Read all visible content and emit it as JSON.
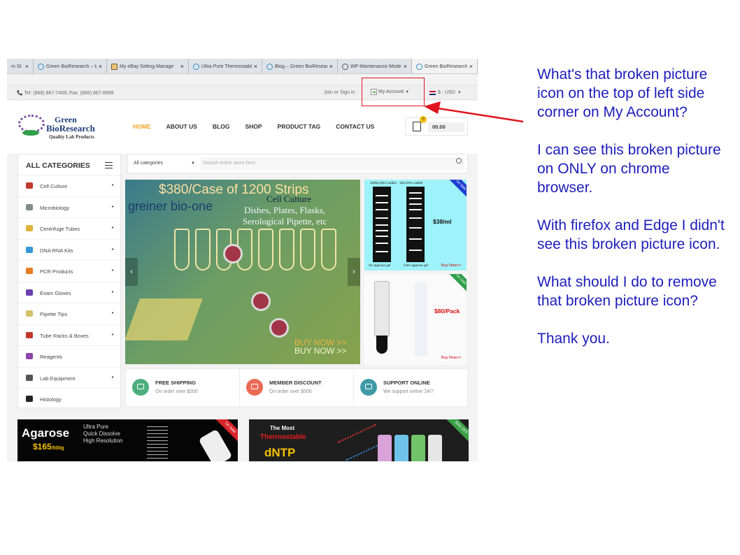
{
  "browser": {
    "tabs": [
      {
        "title": "m St",
        "icon": "page-icon",
        "active": false
      },
      {
        "title": "Green BioResearch – We",
        "icon": "leaf-icon",
        "active": false
      },
      {
        "title": "My eBay Selling Manage",
        "icon": "ebay-icon",
        "active": false
      },
      {
        "title": "Ultra Pure Thermostable",
        "icon": "page-icon",
        "active": false
      },
      {
        "title": "Blog – Green BioResearc",
        "icon": "leaf-icon",
        "active": false
      },
      {
        "title": "WP Maintenance Mode",
        "icon": "wordpress-icon",
        "active": false
      },
      {
        "title": "Green BioResearch – We",
        "icon": "leaf-icon",
        "active": true
      }
    ],
    "close_glyph": "×"
  },
  "topbar": {
    "contact": "📞 Tel: (866) 867-7406; Fax: (866) 867-8958",
    "join": "Join or Sign in",
    "account": "My Account",
    "currency": "$ - USD"
  },
  "logo": {
    "line1": "Green",
    "line2": "BioResearch",
    "line3": "Quality Lab Products"
  },
  "nav": {
    "items": [
      "HOME",
      "ABOUT US",
      "BLOG",
      "SHOP",
      "PRODUCT TAG",
      "CONTACT US"
    ],
    "active": "HOME"
  },
  "cart": {
    "count": "0",
    "total": "00.00"
  },
  "categories": {
    "title": "ALL CATEGORIES",
    "items": [
      {
        "label": "Cell Culture",
        "arrow": true,
        "color": "#c0392b"
      },
      {
        "label": "Microbiology",
        "arrow": true,
        "color": "#7f8c8d"
      },
      {
        "label": "Centrifuge Tubes",
        "arrow": true,
        "color": "#e0b23a"
      },
      {
        "label": "DNA RNA Kits",
        "arrow": true,
        "color": "#3498db"
      },
      {
        "label": "PCR Products",
        "arrow": true,
        "color": "#e67e22"
      },
      {
        "label": "Exam Gloves",
        "arrow": true,
        "color": "#6a3fb0"
      },
      {
        "label": "Pipette Tips",
        "arrow": true,
        "color": "#d4c26a"
      },
      {
        "label": "Tube Racks & Boxes",
        "arrow": true,
        "color": "#c0392b"
      },
      {
        "label": "Reagents",
        "arrow": false,
        "color": "#8e44ad"
      },
      {
        "label": "Lab Equipment",
        "arrow": true,
        "color": "#555555"
      },
      {
        "label": "Histology",
        "arrow": false,
        "color": "#222222"
      }
    ],
    "arrow_glyph": "▸"
  },
  "search": {
    "category": "All categories",
    "placeholder": "Search entire store here"
  },
  "hero": {
    "price": "$380/Case of 1200 Strips",
    "brand": "greiner bio-one",
    "line1": "Cell Culture",
    "line2": "Dishes, Plates, Flasks,",
    "line3": "Serological Pipette, etc",
    "buy1": "BUY NOW >>",
    "buy2": "BUY NOW >>",
    "prev": "‹",
    "next": "›"
  },
  "promo_top": {
    "cap1": "100bp DNA Ladder",
    "cap2": "1Kb DNA Ladder",
    "price": "$38/ml",
    "sale": "On Sale",
    "gel1": "2% agarose gel",
    "gel2": "0.8% agarose gel",
    "buy": "Buy Now>>"
  },
  "promo_bottom": {
    "price": "$80/Pack",
    "sale": "On Sale",
    "buy": "Buy Now>>"
  },
  "features": [
    {
      "title": "FREE SHIPPING",
      "sub": "On order over $200",
      "color": "#4cae7c"
    },
    {
      "title": "MEMBER DISCOUNT",
      "sub": "On order over $500",
      "color": "#ea6a56"
    },
    {
      "title": "SUPPORT ONLINE",
      "sub": "We support online 24/7",
      "color": "#3d9aa6"
    }
  ],
  "banner_agarose": {
    "title": "Agarose",
    "price": "$165",
    "unit": "/500g",
    "lines": [
      "Ultra Pure",
      "Quick Dissolve",
      "High Resolution"
    ],
    "sale": "On Sale"
  },
  "banner_dntp": {
    "most": "The Most",
    "thermo": "Thermostable",
    "title": "dNTP",
    "sale": "50% OFF"
  },
  "question": {
    "paragraphs": [
      "What's that broken picture icon on the top of left side corner on My Account?",
      "I can see this broken picture on ONLY on chrome browser.",
      "With firefox and Edge I didn't see this broken picture icon.",
      "What should I do to remove that broken picture icon?",
      "Thank you."
    ]
  },
  "colors": {
    "accent": "#f0a020",
    "callout": "#e0141e",
    "question": "#1d1dbc"
  }
}
